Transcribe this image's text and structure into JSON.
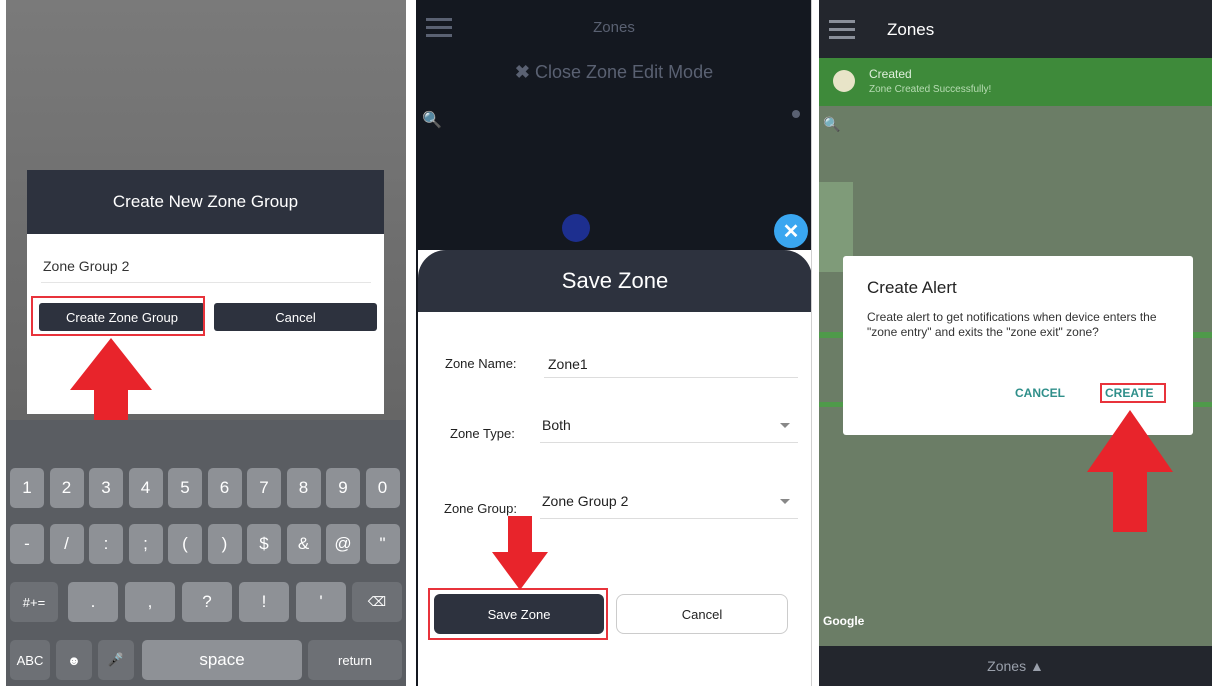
{
  "panel1": {
    "dialog_title": "Create New Zone Group",
    "input_value": "Zone Group 2",
    "create_button": "Create Zone Group",
    "cancel_button": "Cancel",
    "keyboard": {
      "row1": [
        "1",
        "2",
        "3",
        "4",
        "5",
        "6",
        "7",
        "8",
        "9",
        "0"
      ],
      "row2": [
        "-",
        "/",
        ":",
        ";",
        "(",
        ")",
        "$",
        "&",
        "@",
        "\""
      ],
      "row3": [
        "#+=",
        ".",
        ",",
        "?",
        "!",
        "'"
      ],
      "row4": [
        "ABC",
        "space",
        "return"
      ]
    }
  },
  "panel2": {
    "header_title": "Zones",
    "close_edit_label": "Close Zone Edit Mode",
    "sheet_title": "Save Zone",
    "zone_name_label": "Zone Name:",
    "zone_name_value": "Zone1",
    "zone_type_label": "Zone Type:",
    "zone_type_value": "Both",
    "zone_group_label": "Zone Group:",
    "zone_group_value": "Zone Group 2",
    "save_button": "Save Zone",
    "cancel_button": "Cancel"
  },
  "panel3": {
    "header_title": "Zones",
    "toast_title": "Created",
    "toast_message": "Zone Created Successfully!",
    "alert_title": "Create Alert",
    "alert_body": "Create alert to get notifications when device enters the \"zone entry\" and exits the \"zone exit\" zone?",
    "cancel_button": "CANCEL",
    "create_button": "CREATE",
    "map_attribution": "Google",
    "bottom_tab": "Zones"
  },
  "colors": {
    "dark_header": "#2d323e",
    "highlight_red": "#e8333b",
    "accent_blue": "#3aa6f0",
    "toast_green": "#3e8a3a",
    "alert_teal": "#2f8f8a"
  }
}
